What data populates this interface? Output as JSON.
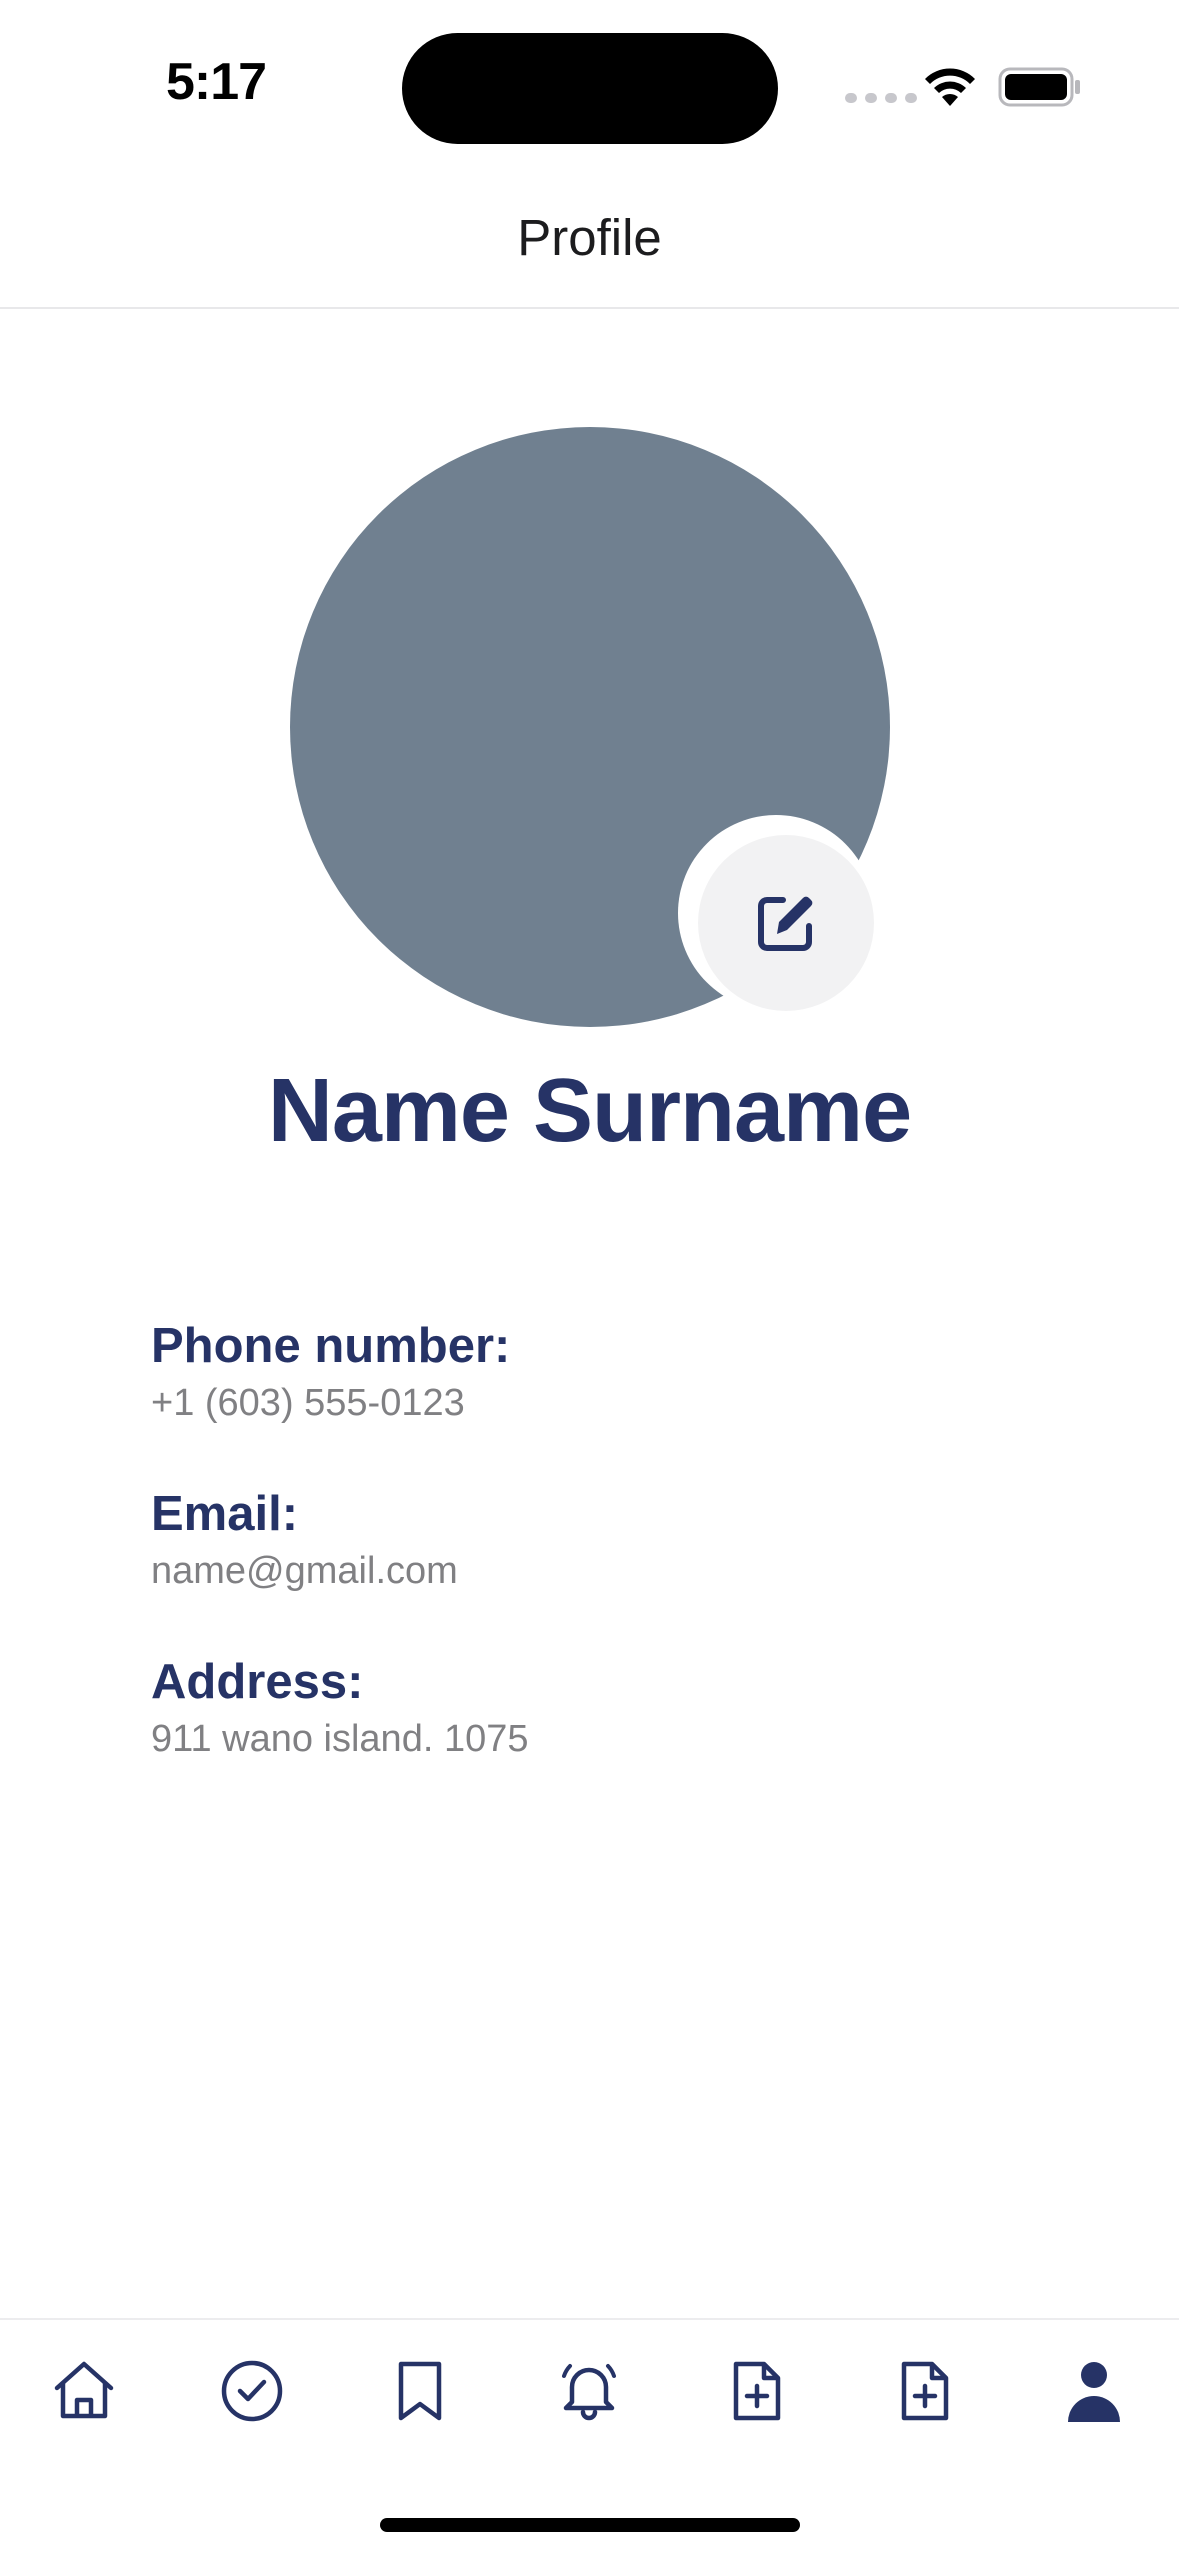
{
  "status_bar": {
    "time": "5:17"
  },
  "header": {
    "title": "Profile"
  },
  "profile": {
    "name": "Name Surname",
    "avatar_color": "#708090",
    "edit_icon": "pencil-square-icon"
  },
  "info": [
    {
      "label": "Phone number:",
      "value": "+1 (603) 555-0123"
    },
    {
      "label": "Email:",
      "value": "name@gmail.com"
    },
    {
      "label": "Address:",
      "value": "911 wano island. 1075"
    }
  ],
  "tab_bar": {
    "items": [
      {
        "icon": "home-icon",
        "active": false
      },
      {
        "icon": "check-circle-icon",
        "active": false
      },
      {
        "icon": "bookmark-icon",
        "active": false
      },
      {
        "icon": "bell-icon",
        "active": false
      },
      {
        "icon": "document-add-icon",
        "active": false
      },
      {
        "icon": "document-add-icon",
        "active": false
      },
      {
        "icon": "user-icon",
        "active": true
      }
    ]
  },
  "colors": {
    "primary": "#263366",
    "muted_text": "#808083",
    "divider": "#e8e8ea"
  }
}
